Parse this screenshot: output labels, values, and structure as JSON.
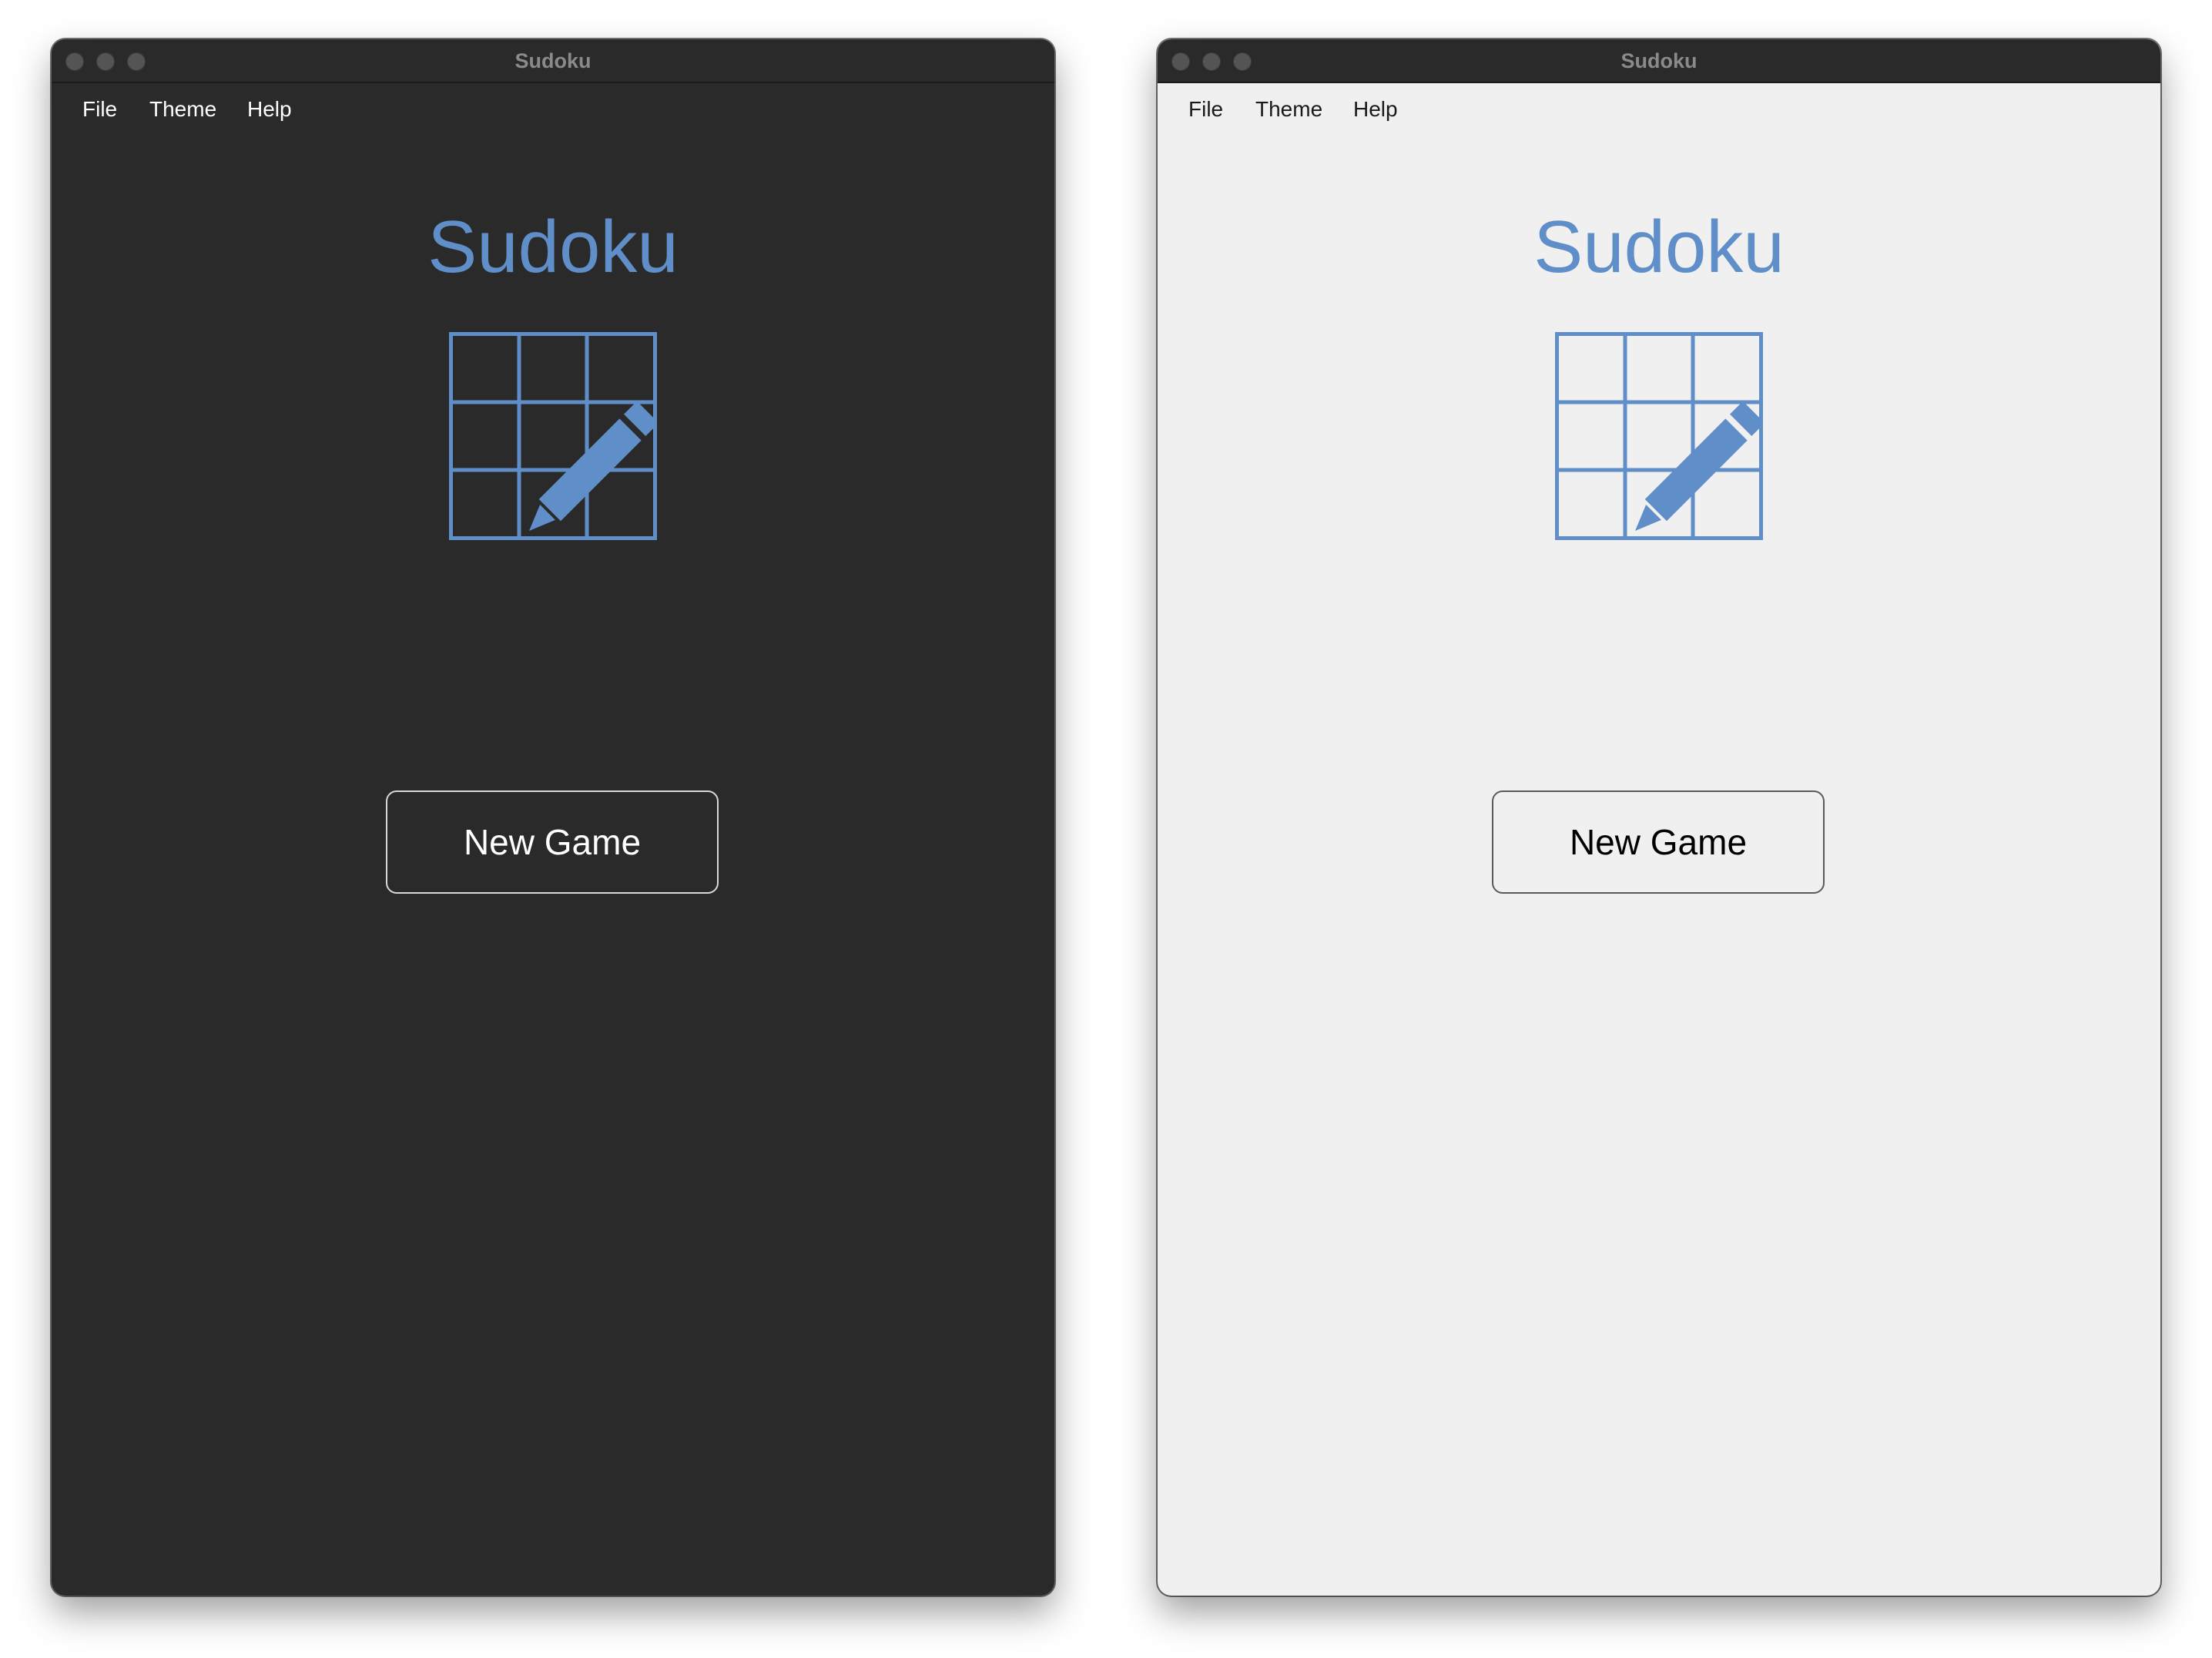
{
  "colors": {
    "accent": "#5f8ec8",
    "dark_background": "#2a2a2a",
    "light_background": "#f0f0f0",
    "titlebar": "#2a2a2a",
    "traffic_light": "#545454"
  },
  "windows": {
    "dark": {
      "theme": "dark",
      "title": "Sudoku",
      "menu": {
        "file": "File",
        "theme": "Theme",
        "help": "Help"
      },
      "heading": "Sudoku",
      "icon": "sudoku-grid-pencil-icon",
      "new_game_label": "New Game"
    },
    "light": {
      "theme": "light",
      "title": "Sudoku",
      "menu": {
        "file": "File",
        "theme": "Theme",
        "help": "Help"
      },
      "heading": "Sudoku",
      "icon": "sudoku-grid-pencil-icon",
      "new_game_label": "New Game"
    }
  }
}
